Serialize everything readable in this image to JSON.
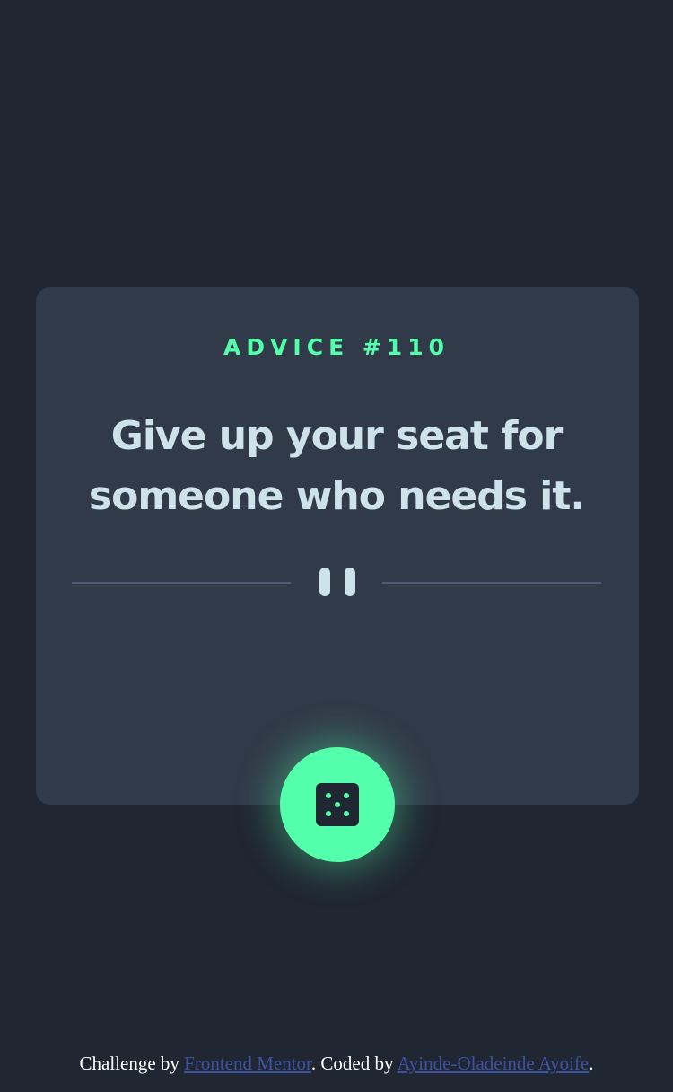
{
  "card": {
    "advice_label": "ADVICE #110",
    "advice_text": "Give up your seat for someone who needs it."
  },
  "icons": {
    "divider": "pause-icon",
    "dice": "dice-icon"
  },
  "colors": {
    "background": "#202632",
    "card": "#313a48",
    "accent": "#53ffaa",
    "text": "#cee3e9",
    "divider": "#4f5d74",
    "link": "#3e52a3"
  },
  "footer": {
    "prefix": "Challenge by ",
    "link1": "Frontend Mentor",
    "middle": ". Coded by ",
    "link2": "Ayinde-Oladeinde Ayoife",
    "suffix": "."
  }
}
